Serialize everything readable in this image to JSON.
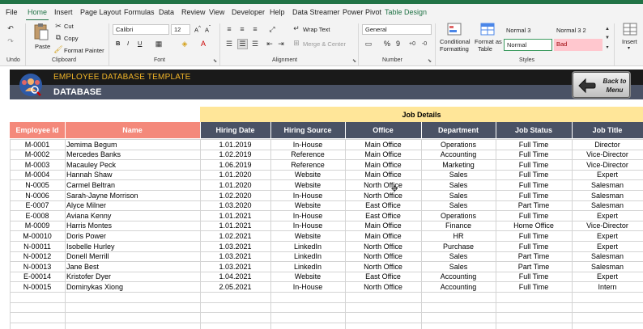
{
  "menu": {
    "tabs": [
      "File",
      "Home",
      "Insert",
      "Page Layout",
      "Formulas",
      "Data",
      "Review",
      "View",
      "Developer",
      "Help",
      "Data Streamer",
      "Power Pivot",
      "Table Design"
    ],
    "active": "Home"
  },
  "ribbon": {
    "undo_label": "Undo",
    "clipboard": {
      "paste": "Paste",
      "cut": "Cut",
      "copy": "Copy",
      "format_painter": "Format Painter",
      "group": "Clipboard"
    },
    "font": {
      "name": "Calibri",
      "size": "12",
      "bold": "B",
      "italic": "I",
      "underline": "U",
      "group": "Font"
    },
    "alignment": {
      "wrap": "Wrap Text",
      "merge": "Merge & Center",
      "group": "Alignment"
    },
    "number": {
      "format": "General",
      "percent": "%",
      "comma": "9",
      "group": "Number"
    },
    "styles": {
      "conditional": "Conditional",
      "conditional2": "Formatting",
      "format_as": "Format as",
      "format_as2": "Table",
      "normal3": "Normal 3",
      "normal32": "Normal 3 2",
      "normal": "Normal",
      "bad": "Bad",
      "group": "Styles"
    },
    "insert": "Insert"
  },
  "sheet": {
    "template_title": "EMPLOYEE DATABASE TEMPLATE",
    "database_label": "DATABASE",
    "back_button": "Back to Menu",
    "job_details": "Job Details",
    "headers": [
      "Employee Id",
      "Name",
      "Hiring Date",
      "Hiring Source",
      "Office",
      "Department",
      "Job Status",
      "Job Title"
    ],
    "rows": [
      [
        "M-0001",
        "Jemima Begum",
        "1.01.2019",
        "In-House",
        "Main Office",
        "Operations",
        "Full Time",
        "Director"
      ],
      [
        "M-0002",
        "Mercedes Banks",
        "1.02.2019",
        "Reference",
        "Main Office",
        "Accounting",
        "Full Time",
        "Vice-Director"
      ],
      [
        "M-0003",
        "Macauley Peck",
        "1.06.2019",
        "Reference",
        "Main Office",
        "Marketing",
        "Full Time",
        "Vice-Director"
      ],
      [
        "M-0004",
        "Hannah Shaw",
        "1.01.2020",
        "Website",
        "Main Office",
        "Sales",
        "Full Time",
        "Expert"
      ],
      [
        "N-0005",
        "Carmel Beltran",
        "1.01.2020",
        "Website",
        "North Office",
        "Sales",
        "Full Time",
        "Salesman"
      ],
      [
        "N-0006",
        "Sarah-Jayne Morrison",
        "1.02.2020",
        "In-House",
        "North Office",
        "Sales",
        "Full Time",
        "Salesman"
      ],
      [
        "E-0007",
        "Alyce Milner",
        "1.03.2020",
        "Website",
        "East Office",
        "Sales",
        "Part Time",
        "Salesman"
      ],
      [
        "E-0008",
        "Aviana Kenny",
        "1.01.2021",
        "In-House",
        "East Office",
        "Operations",
        "Full Time",
        "Expert"
      ],
      [
        "M-0009",
        "Harris Montes",
        "1.01.2021",
        "In-House",
        "Main Office",
        "Finance",
        "Home Office",
        "Vice-Director"
      ],
      [
        "M-00010",
        "Doris Power",
        "1.02.2021",
        "Website",
        "Main Office",
        "HR",
        "Full Time",
        "Expert"
      ],
      [
        "N-00011",
        "Isobelle Hurley",
        "1.03.2021",
        "LinkedIn",
        "North Office",
        "Purchase",
        "Full Time",
        "Expert"
      ],
      [
        "N-00012",
        "Donell Merrill",
        "1.03.2021",
        "LinkedIn",
        "North Office",
        "Sales",
        "Part Time",
        "Salesman"
      ],
      [
        "N-00013",
        "Jane Best",
        "1.03.2021",
        "LinkedIn",
        "North Office",
        "Sales",
        "Part Time",
        "Salesman"
      ],
      [
        "E-00014",
        "Kristofer Dyer",
        "1.04.2021",
        "Website",
        "East Office",
        "Accounting",
        "Full Time",
        "Expert"
      ],
      [
        "N-00015",
        "Dominykas Xiong",
        "2.05.2021",
        "In-House",
        "North Office",
        "Accounting",
        "Full Time",
        "Intern"
      ]
    ]
  }
}
